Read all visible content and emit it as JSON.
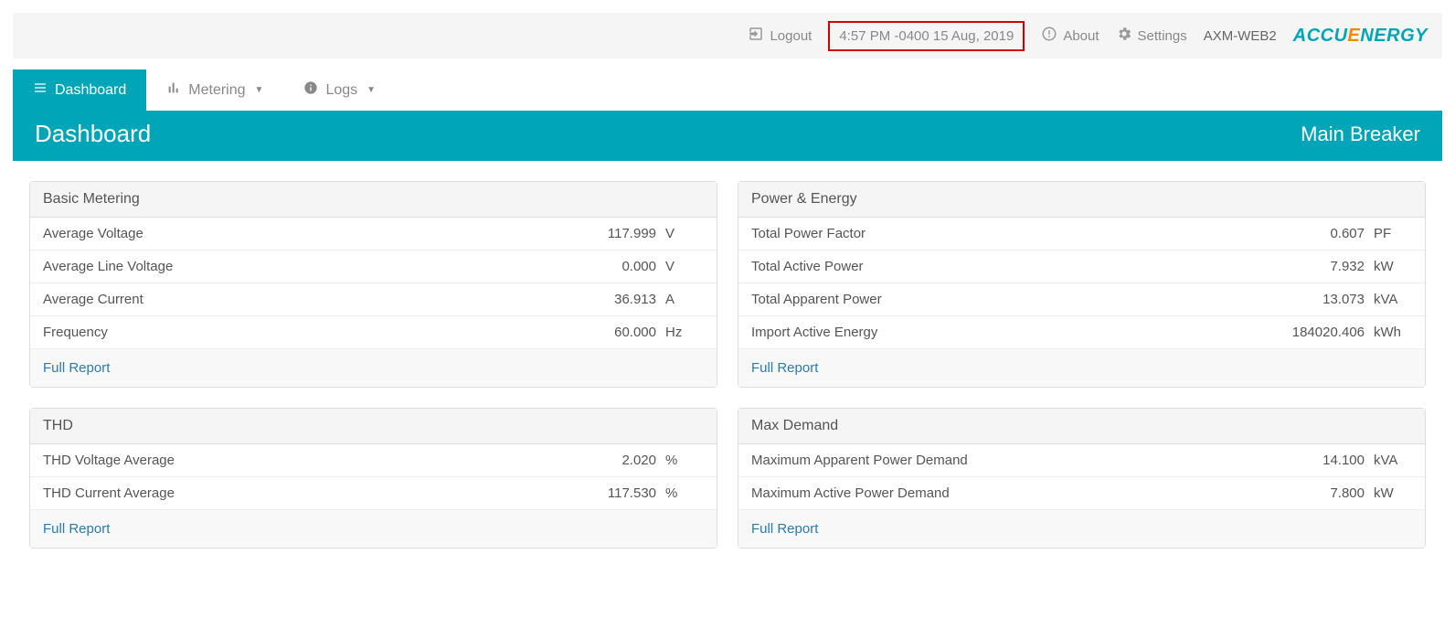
{
  "topbar": {
    "logout": "Logout",
    "datetime": "4:57 PM -0400 15 Aug, 2019",
    "about": "About",
    "settings": "Settings",
    "device": "AXM-WEB2",
    "brand_a": "ACCU",
    "brand_b": "E",
    "brand_c": "NERGY"
  },
  "nav": {
    "dashboard": "Dashboard",
    "metering": "Metering",
    "logs": "Logs"
  },
  "header": {
    "title": "Dashboard",
    "location": "Main Breaker"
  },
  "panels": {
    "full_report": "Full Report",
    "basic": {
      "title": "Basic Metering",
      "rows": [
        {
          "label": "Average Voltage",
          "value": "117.999",
          "unit": "V"
        },
        {
          "label": "Average Line Voltage",
          "value": "0.000",
          "unit": "V"
        },
        {
          "label": "Average Current",
          "value": "36.913",
          "unit": "A"
        },
        {
          "label": "Frequency",
          "value": "60.000",
          "unit": "Hz"
        }
      ]
    },
    "power": {
      "title": "Power & Energy",
      "rows": [
        {
          "label": "Total Power Factor",
          "value": "0.607",
          "unit": "PF"
        },
        {
          "label": "Total Active Power",
          "value": "7.932",
          "unit": "kW"
        },
        {
          "label": "Total Apparent Power",
          "value": "13.073",
          "unit": "kVA"
        },
        {
          "label": "Import Active Energy",
          "value": "184020.406",
          "unit": "kWh"
        }
      ]
    },
    "thd": {
      "title": "THD",
      "rows": [
        {
          "label": "THD Voltage Average",
          "value": "2.020",
          "unit": "%"
        },
        {
          "label": "THD Current Average",
          "value": "117.530",
          "unit": "%"
        }
      ]
    },
    "max": {
      "title": "Max Demand",
      "rows": [
        {
          "label": "Maximum Apparent Power Demand",
          "value": "14.100",
          "unit": "kVA"
        },
        {
          "label": "Maximum Active Power Demand",
          "value": "7.800",
          "unit": "kW"
        }
      ]
    }
  }
}
